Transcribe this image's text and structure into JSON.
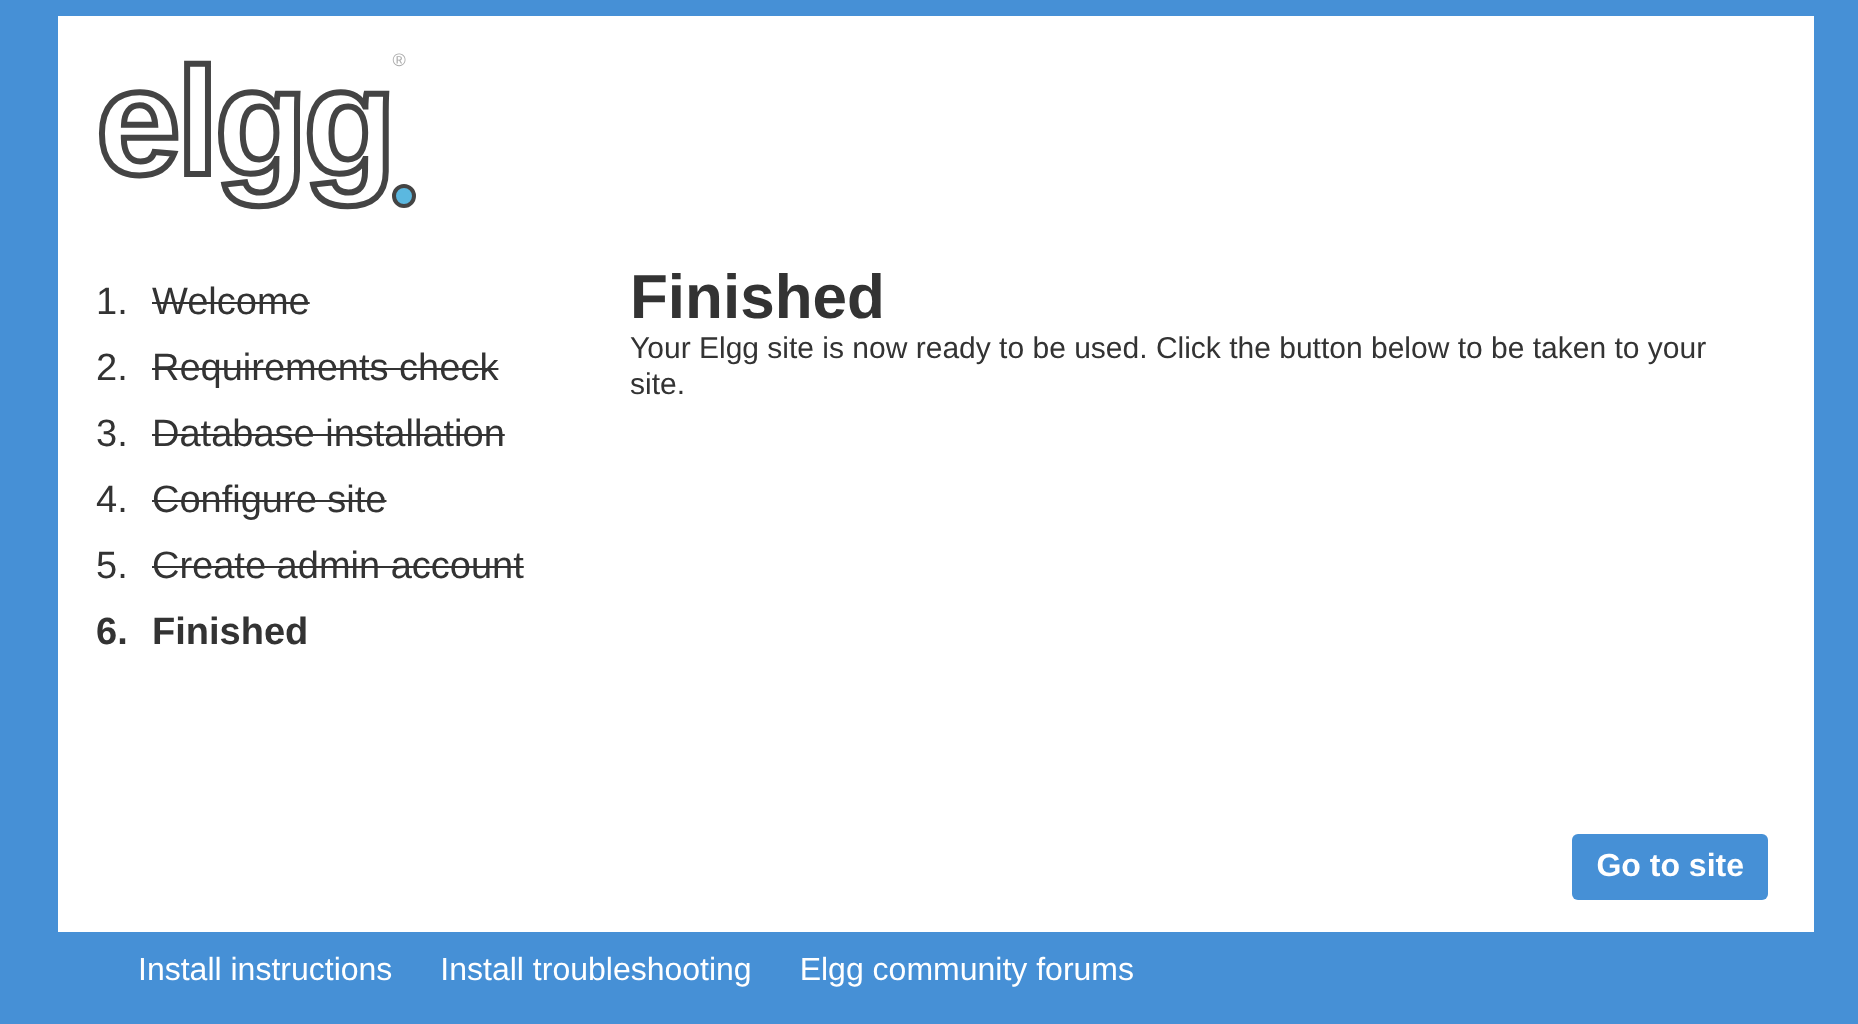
{
  "logo": {
    "text": "elgg",
    "mark": "®"
  },
  "steps": [
    {
      "number": "1.",
      "label": "Welcome",
      "done": true,
      "selected": false
    },
    {
      "number": "2.",
      "label": "Requirements check",
      "done": true,
      "selected": false
    },
    {
      "number": "3.",
      "label": "Database installation",
      "done": true,
      "selected": false
    },
    {
      "number": "4.",
      "label": "Configure site",
      "done": true,
      "selected": false
    },
    {
      "number": "5.",
      "label": "Create admin account",
      "done": true,
      "selected": false
    },
    {
      "number": "6.",
      "label": "Finished",
      "done": false,
      "selected": true
    }
  ],
  "content": {
    "title": "Finished",
    "text": "Your Elgg site is now ready to be used. Click the button below to be taken to your site."
  },
  "button": "Go to site",
  "footer_links": [
    "Install instructions",
    "Install troubleshooting",
    "Elgg community forums"
  ]
}
